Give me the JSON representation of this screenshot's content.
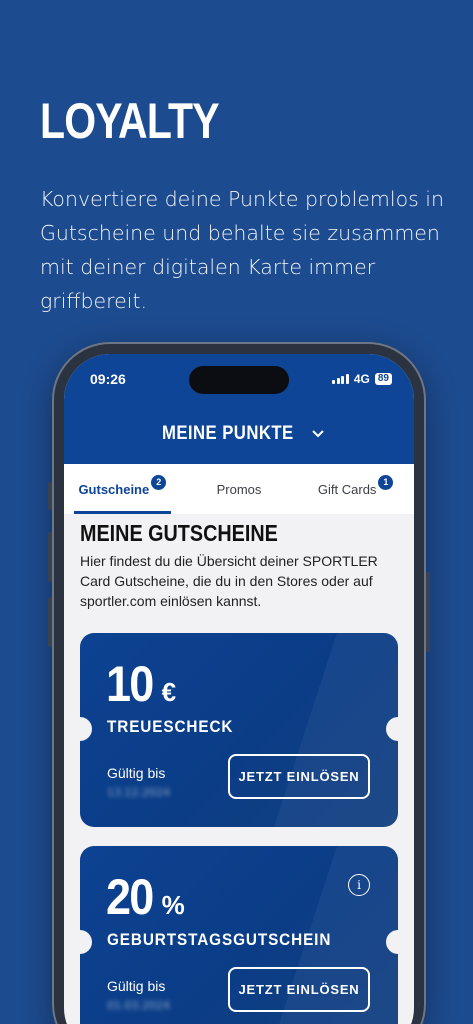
{
  "headline": "LOYALTY",
  "subtitle": "Konvertiere deine Punkte problemlos in Gutscheine und behalte sie zusammen mit deiner digitalen Karte immer griffbereit.",
  "status_bar": {
    "time": "09:26",
    "network": "4G",
    "battery": "89"
  },
  "app_bar": {
    "title": "MEINE PUNKTE",
    "dropdown_icon": "chevron-down-icon"
  },
  "tabs": [
    {
      "label": "Gutscheine",
      "badge": "2",
      "active": true
    },
    {
      "label": "Promos",
      "badge": "",
      "active": false
    },
    {
      "label": "Gift Cards",
      "badge": "1",
      "active": false
    }
  ],
  "section": {
    "title": "MEINE GUTSCHEINE",
    "description": "Hier findest du die Übersicht deiner SPORTLER Card Gutscheine, die du in den Stores oder auf sportler.com einlösen kannst."
  },
  "vouchers": [
    {
      "amount": "10",
      "unit": "€",
      "name": "TREUESCHECK",
      "valid_label": "Gültig bis",
      "valid_date": "13.12.2024",
      "button": "JETZT EINLÖSEN",
      "info_icon": false
    },
    {
      "amount": "20",
      "unit": "%",
      "name": "GEBURTSTAGSGUTSCHEIN",
      "valid_label": "Gültig bis",
      "valid_date": "01.03.2024",
      "button": "JETZT EINLÖSEN",
      "info_icon": true
    }
  ],
  "colors": {
    "background": "#1d4b8f",
    "brand": "#0e4596"
  }
}
